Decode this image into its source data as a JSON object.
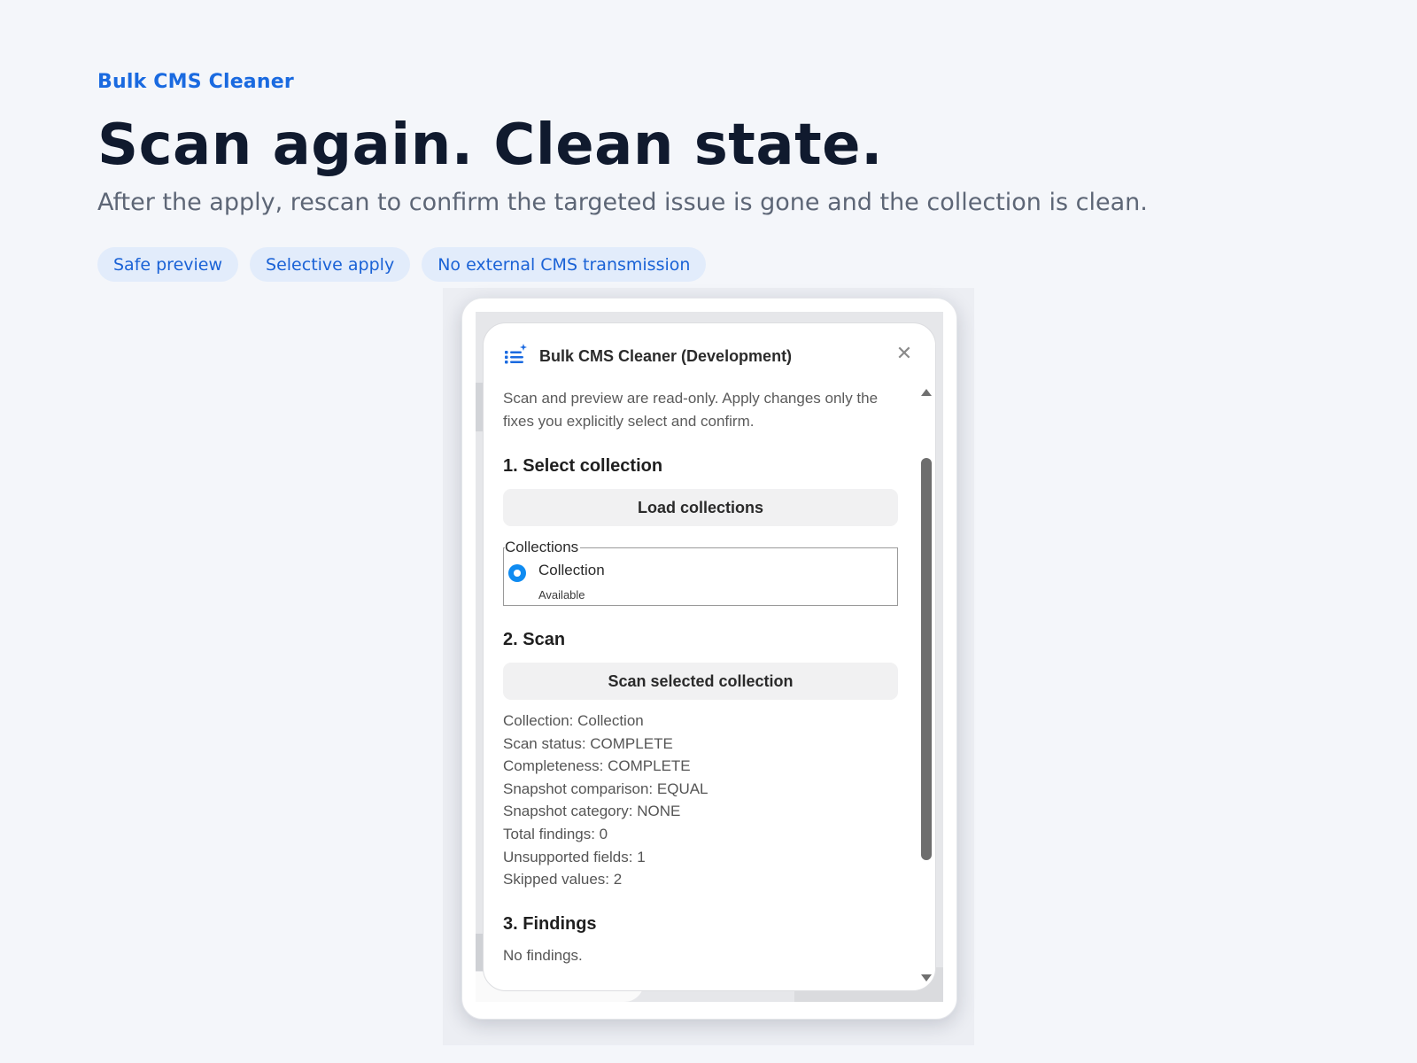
{
  "hero": {
    "eyebrow": "Bulk CMS Cleaner",
    "headline": "Scan again. Clean state.",
    "subhead": "After the apply, rescan to confirm the targeted issue is gone and the collection is clean.",
    "chips": [
      "Safe preview",
      "Selective apply",
      "No external CMS transmission"
    ]
  },
  "panel": {
    "title": "Bulk CMS Cleaner (Development)",
    "close_icon": "close-icon",
    "app_icon": "list-sparkle-icon",
    "accent_color": "#0f8bf1",
    "intro": "Scan and preview are read-only. Apply changes only the fixes you explicitly select and confirm.",
    "section1": {
      "title": "1. Select collection",
      "button": "Load collections",
      "legend": "Collections",
      "option": {
        "name": "Collection",
        "status": "Available",
        "selected": true
      }
    },
    "section2": {
      "title": "2. Scan",
      "button": "Scan selected collection",
      "stats": [
        "Collection: Collection",
        "Scan status: COMPLETE",
        "Completeness: COMPLETE",
        "Snapshot comparison: EQUAL",
        "Snapshot category: NONE",
        "Total findings: 0",
        "Unsupported fields: 1",
        "Skipped values: 2"
      ]
    },
    "section3": {
      "title": "3. Findings",
      "empty": "No findings."
    }
  },
  "colors": {
    "brand": "#1a6ae0",
    "headline": "#101a2e",
    "chip_bg": "#e2ecfb"
  }
}
